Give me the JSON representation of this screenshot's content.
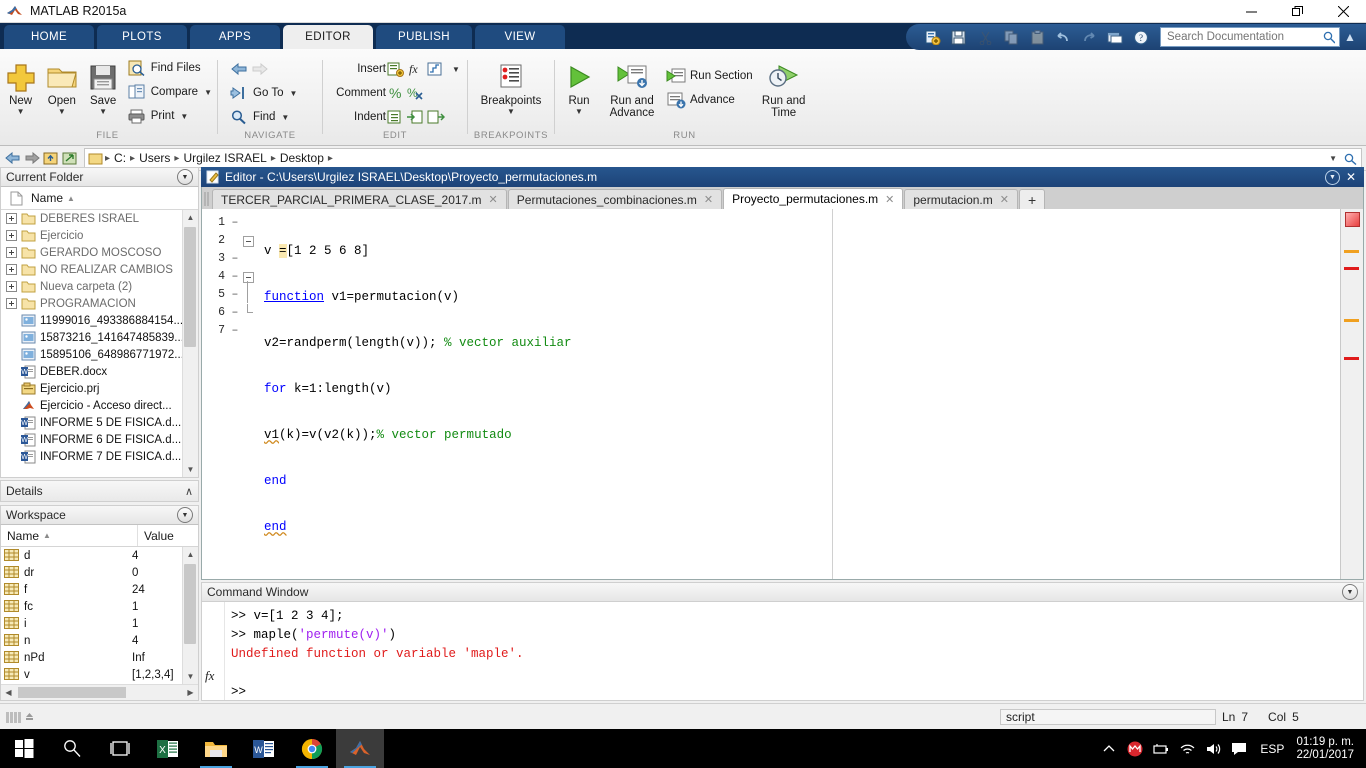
{
  "window": {
    "title": "MATLAB R2015a",
    "minimize_label": "—",
    "maximize_label": "❐",
    "close_label": "✕"
  },
  "ribbon": {
    "tabs": [
      {
        "label": "HOME",
        "active": false
      },
      {
        "label": "PLOTS",
        "active": false
      },
      {
        "label": "APPS",
        "active": false
      },
      {
        "label": "EDITOR",
        "active": true
      },
      {
        "label": "PUBLISH",
        "active": false
      },
      {
        "label": "VIEW",
        "active": false
      }
    ],
    "quick_access": {
      "icons": [
        "new-script-icon",
        "save-icon",
        "cut-icon",
        "copy-icon",
        "paste-icon",
        "undo-icon",
        "redo-icon",
        "switch-window-icon",
        "help-icon"
      ],
      "search_placeholder": "Search Documentation",
      "search_value": "",
      "collapse_label": "▲"
    },
    "groups": [
      {
        "name": "FILE",
        "label": "FILE",
        "big_buttons": [
          {
            "label": "New",
            "icon": "new-file-icon",
            "has_caret": true
          },
          {
            "label": "Open",
            "icon": "open-folder-icon",
            "has_caret": true
          },
          {
            "label": "Save",
            "icon": "save-disk-icon",
            "has_caret": true
          }
        ],
        "small_buttons": [
          {
            "label": "Find Files",
            "icon": "find-files-icon",
            "has_caret": false
          },
          {
            "label": "Compare",
            "icon": "compare-icon",
            "has_caret": true
          },
          {
            "label": "Print",
            "icon": "print-icon",
            "has_caret": true
          }
        ]
      },
      {
        "name": "NAVIGATE",
        "label": "NAVIGATE",
        "small_buttons": [
          {
            "label": "",
            "icon": "back-arrow-icon",
            "has_caret": false
          },
          {
            "label": "Go To",
            "icon": "go-to-icon",
            "has_caret": true
          },
          {
            "label": "Find",
            "icon": "find-magnifier-icon",
            "has_caret": true
          }
        ]
      },
      {
        "name": "EDIT",
        "label": "EDIT",
        "rows": [
          {
            "label": "Insert",
            "icons": [
              "insert-icon",
              "fx-icon",
              "fi-icon"
            ],
            "has_caret": true
          },
          {
            "label": "Comment",
            "icons": [
              "comment-percent-icon",
              "uncomment-icon"
            ],
            "has_caret": false
          },
          {
            "label": "Indent",
            "icons": [
              "indent-icon",
              "indent-right-icon",
              "indent-left-icon"
            ],
            "has_caret": false
          }
        ]
      },
      {
        "name": "BREAKPOINTS",
        "label": "BREAKPOINTS",
        "big_buttons": [
          {
            "label": "Breakpoints",
            "icon": "breakpoints-icon",
            "has_caret": true
          }
        ]
      },
      {
        "name": "RUN",
        "label": "RUN",
        "big_buttons": [
          {
            "label": "Run",
            "icon": "run-play-icon",
            "has_caret": true
          },
          {
            "label": "Run and\nAdvance",
            "icon": "run-advance-icon",
            "has_caret": false
          },
          {
            "label": "Run and\nTime",
            "icon": "run-time-icon",
            "has_caret": false
          }
        ],
        "small_buttons": [
          {
            "label": "Run Section",
            "icon": "run-section-icon",
            "has_caret": false
          },
          {
            "label": "Advance",
            "icon": "advance-icon",
            "has_caret": false
          }
        ]
      }
    ]
  },
  "addressbar": {
    "back_icon": "back-arrow-icon",
    "forward_icon": "forward-arrow-icon",
    "up_icon": "up-folder-icon",
    "browse_icon": "browse-folder-icon",
    "crumbs": [
      "C:",
      "Users",
      "Urgilez ISRAEL",
      "Desktop"
    ],
    "separator": "▸"
  },
  "current_folder": {
    "title": "Current Folder",
    "column_header": "Name",
    "sort_arrow": "▲",
    "items": [
      {
        "name": "DEBERES ISRAEL",
        "type": "folder"
      },
      {
        "name": "Ejercicio",
        "type": "folder"
      },
      {
        "name": "GERARDO MOSCOSO",
        "type": "folder"
      },
      {
        "name": "NO REALIZAR CAMBIOS",
        "type": "folder"
      },
      {
        "name": "Nueva carpeta (2)",
        "type": "folder"
      },
      {
        "name": "PROGRAMACION",
        "type": "folder"
      },
      {
        "name": "11999016_493386884154...",
        "type": "image"
      },
      {
        "name": "15873216_141647485839...",
        "type": "image"
      },
      {
        "name": "15895106_648986771972...",
        "type": "image"
      },
      {
        "name": "DEBER.docx",
        "type": "word"
      },
      {
        "name": "Ejercicio.prj",
        "type": "prj"
      },
      {
        "name": "Ejercicio - Acceso direct...",
        "type": "shortcut"
      },
      {
        "name": "INFORME 5 DE FÍSICA.d...",
        "type": "word"
      },
      {
        "name": "INFORME 6 DE FÍSICA.d...",
        "type": "word"
      },
      {
        "name": "INFORME 7 DE FÍSICA.d...",
        "type": "word"
      }
    ]
  },
  "details": {
    "title": "Details",
    "collapse_arrow": "∧"
  },
  "workspace": {
    "title": "Workspace",
    "columns": [
      "Name",
      "Value"
    ],
    "sort_arrow": "▲",
    "rows": [
      {
        "name": "d",
        "value": "4"
      },
      {
        "name": "dr",
        "value": "0"
      },
      {
        "name": "f",
        "value": "24"
      },
      {
        "name": "fc",
        "value": "1"
      },
      {
        "name": "i",
        "value": "1"
      },
      {
        "name": "n",
        "value": "4"
      },
      {
        "name": "nPd",
        "value": "Inf"
      },
      {
        "name": "v",
        "value": "[1,2,3,4]"
      }
    ]
  },
  "editor": {
    "title": "Editor - C:\\Users\\Urgilez ISRAEL\\Desktop\\Proyecto_permutaciones.m",
    "titlebar_icon": "editor-pencil-icon",
    "tabs": [
      {
        "label": "TERCER_PARCIAL_PRIMERA_CLASE_2017.m",
        "active": false,
        "closable": true
      },
      {
        "label": "Permutaciones_combinaciones.m",
        "active": false,
        "closable": true
      },
      {
        "label": "Proyecto_permutaciones.m",
        "active": true,
        "closable": true
      },
      {
        "label": "permutacion.m",
        "active": false,
        "closable": true
      }
    ],
    "add_tab_label": "+",
    "lines": [
      {
        "number": "1",
        "dash": "–",
        "text": "v =[1 2 5 6 8]"
      },
      {
        "number": "2",
        "dash": "",
        "text": "function v1=permutacion(v)"
      },
      {
        "number": "3",
        "dash": "–",
        "text": "v2=randperm(length(v)); % vector auxiliar"
      },
      {
        "number": "4",
        "dash": "–",
        "text": "for k=1:length(v)"
      },
      {
        "number": "5",
        "dash": "–",
        "text": "v1(k)=v(v2(k));% vector permutado"
      },
      {
        "number": "6",
        "dash": "–",
        "text": "end"
      },
      {
        "number": "7",
        "dash": "–",
        "text": "end"
      }
    ]
  },
  "command_window": {
    "title": "Command Window",
    "prompt_icon": "fx-icon",
    "lines": [
      {
        "prompt": ">> ",
        "text": "v=[1 2 3 4];",
        "kind": "input"
      },
      {
        "prompt": ">> ",
        "text": "maple('permute(v)')",
        "kind": "input-string"
      },
      {
        "prompt": "",
        "text": "Undefined function or variable 'maple'.",
        "kind": "error"
      }
    ],
    "current_prompt": ">>"
  },
  "statusbar": {
    "mode": "script",
    "ln_label": "Ln",
    "ln_value": "7",
    "col_label": "Col",
    "col_value": "5"
  },
  "taskbar": {
    "items": [
      {
        "icon": "windows-start-icon",
        "name": "start-button",
        "active": false,
        "running": false
      },
      {
        "icon": "search-icon",
        "name": "taskbar-search",
        "active": false,
        "running": false
      },
      {
        "icon": "task-view-icon",
        "name": "task-view",
        "active": false,
        "running": false
      },
      {
        "icon": "excel-icon",
        "name": "taskbar-excel",
        "active": false,
        "running": false
      },
      {
        "icon": "file-explorer-icon",
        "name": "taskbar-explorer",
        "active": false,
        "running": true
      },
      {
        "icon": "word-icon",
        "name": "taskbar-word",
        "active": false,
        "running": false
      },
      {
        "icon": "chrome-icon",
        "name": "taskbar-chrome",
        "active": false,
        "running": true
      },
      {
        "icon": "matlab-icon",
        "name": "taskbar-matlab",
        "active": true,
        "running": true
      }
    ],
    "tray": {
      "chevron": "∧",
      "icons": [
        "mega-icon",
        "battery-icon",
        "wifi-icon",
        "volume-icon",
        "action-center-icon"
      ],
      "language": "ESP",
      "time": "01:19 p. m.",
      "date": "22/01/2017"
    }
  },
  "colors": {
    "ribbon_blue": "#0e2c52",
    "tab_blue": "#1f4b7f",
    "editor_title_blue": "#27568e",
    "keyword": "#0000ff",
    "comment": "#128b12",
    "error_red": "#e01b1b",
    "string_purple": "#a020f0",
    "highlight_yellow": "#fae8b0",
    "taskbar_black": "#000000"
  }
}
